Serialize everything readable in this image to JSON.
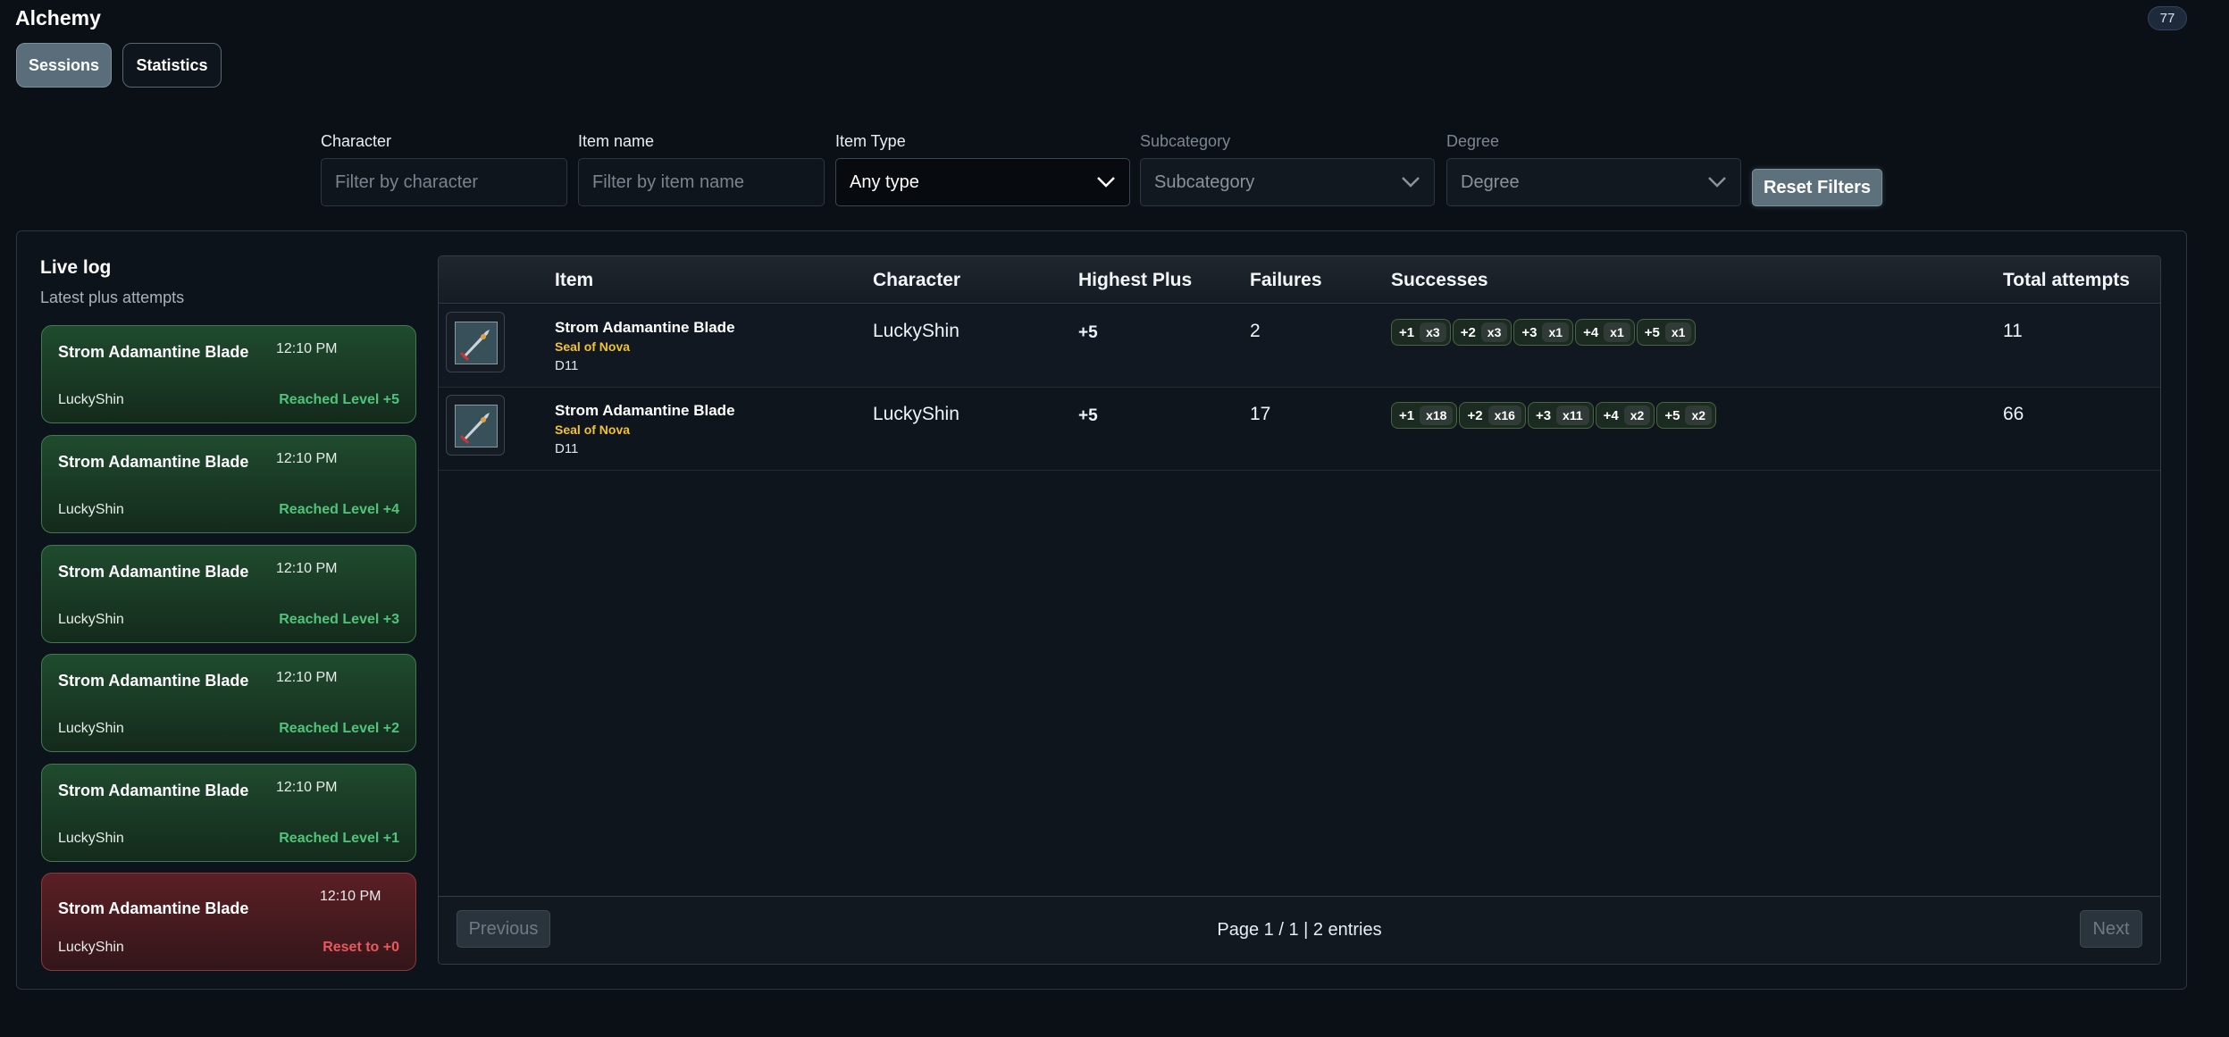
{
  "app": {
    "title": "Alchemy",
    "version": "77"
  },
  "tabs": [
    {
      "label": "Sessions"
    },
    {
      "label": "Statistics"
    }
  ],
  "filters": {
    "character": {
      "label": "Character",
      "placeholder": "Filter by character",
      "value": ""
    },
    "item_name": {
      "label": "Item name",
      "placeholder": "Filter by item name",
      "value": ""
    },
    "item_type": {
      "label": "Item Type",
      "value": "Any type"
    },
    "subcategory": {
      "label": "Subcategory",
      "value": "Subcategory"
    },
    "degree": {
      "label": "Degree",
      "value": "Degree"
    },
    "reset_label": "Reset Filters"
  },
  "live_log": {
    "title": "Live log",
    "subtitle": "Latest plus attempts",
    "entries": [
      {
        "item": "Strom Adamantine Blade",
        "character": "LuckyShin",
        "time": "12:10 PM",
        "status": "Reached Level +5",
        "result": "success"
      },
      {
        "item": "Strom Adamantine Blade",
        "character": "LuckyShin",
        "time": "12:10 PM",
        "status": "Reached Level +4",
        "result": "success"
      },
      {
        "item": "Strom Adamantine Blade",
        "character": "LuckyShin",
        "time": "12:10 PM",
        "status": "Reached Level +3",
        "result": "success"
      },
      {
        "item": "Strom Adamantine Blade",
        "character": "LuckyShin",
        "time": "12:10 PM",
        "status": "Reached Level +2",
        "result": "success"
      },
      {
        "item": "Strom Adamantine Blade",
        "character": "LuckyShin",
        "time": "12:10 PM",
        "status": "Reached Level +1",
        "result": "success"
      },
      {
        "item": "Strom Adamantine Blade",
        "character": "LuckyShin",
        "time": "12:10 PM",
        "status": "Reset to +0",
        "result": "failure"
      }
    ]
  },
  "table": {
    "headers": {
      "item": "Item",
      "character": "Character",
      "highest_plus": "Highest Plus",
      "failures": "Failures",
      "successes": "Successes",
      "total_attempts": "Total attempts"
    },
    "rows": [
      {
        "item": "Strom Adamantine Blade",
        "set": "Seal of Nova",
        "degree": "D11",
        "character": "LuckyShin",
        "highest_plus": "+5",
        "failures": "2",
        "total_attempts": "11",
        "successes": [
          {
            "plus": "+1",
            "count": "x3"
          },
          {
            "plus": "+2",
            "count": "x3"
          },
          {
            "plus": "+3",
            "count": "x1"
          },
          {
            "plus": "+4",
            "count": "x1"
          },
          {
            "plus": "+5",
            "count": "x1"
          }
        ]
      },
      {
        "item": "Strom Adamantine Blade",
        "set": "Seal of Nova",
        "degree": "D11",
        "character": "LuckyShin",
        "highest_plus": "+5",
        "failures": "17",
        "total_attempts": "66",
        "successes": [
          {
            "plus": "+1",
            "count": "x18"
          },
          {
            "plus": "+2",
            "count": "x16"
          },
          {
            "plus": "+3",
            "count": "x11"
          },
          {
            "plus": "+4",
            "count": "x2"
          },
          {
            "plus": "+5",
            "count": "x2"
          }
        ]
      }
    ],
    "pagination": {
      "previous": "Previous",
      "next": "Next",
      "info": "Page 1 / 1 | 2 entries"
    }
  },
  "colors": {
    "success": "#4fc47a",
    "failure": "#e8595e",
    "set_name": "#f2c230",
    "background": "#0b1016"
  }
}
